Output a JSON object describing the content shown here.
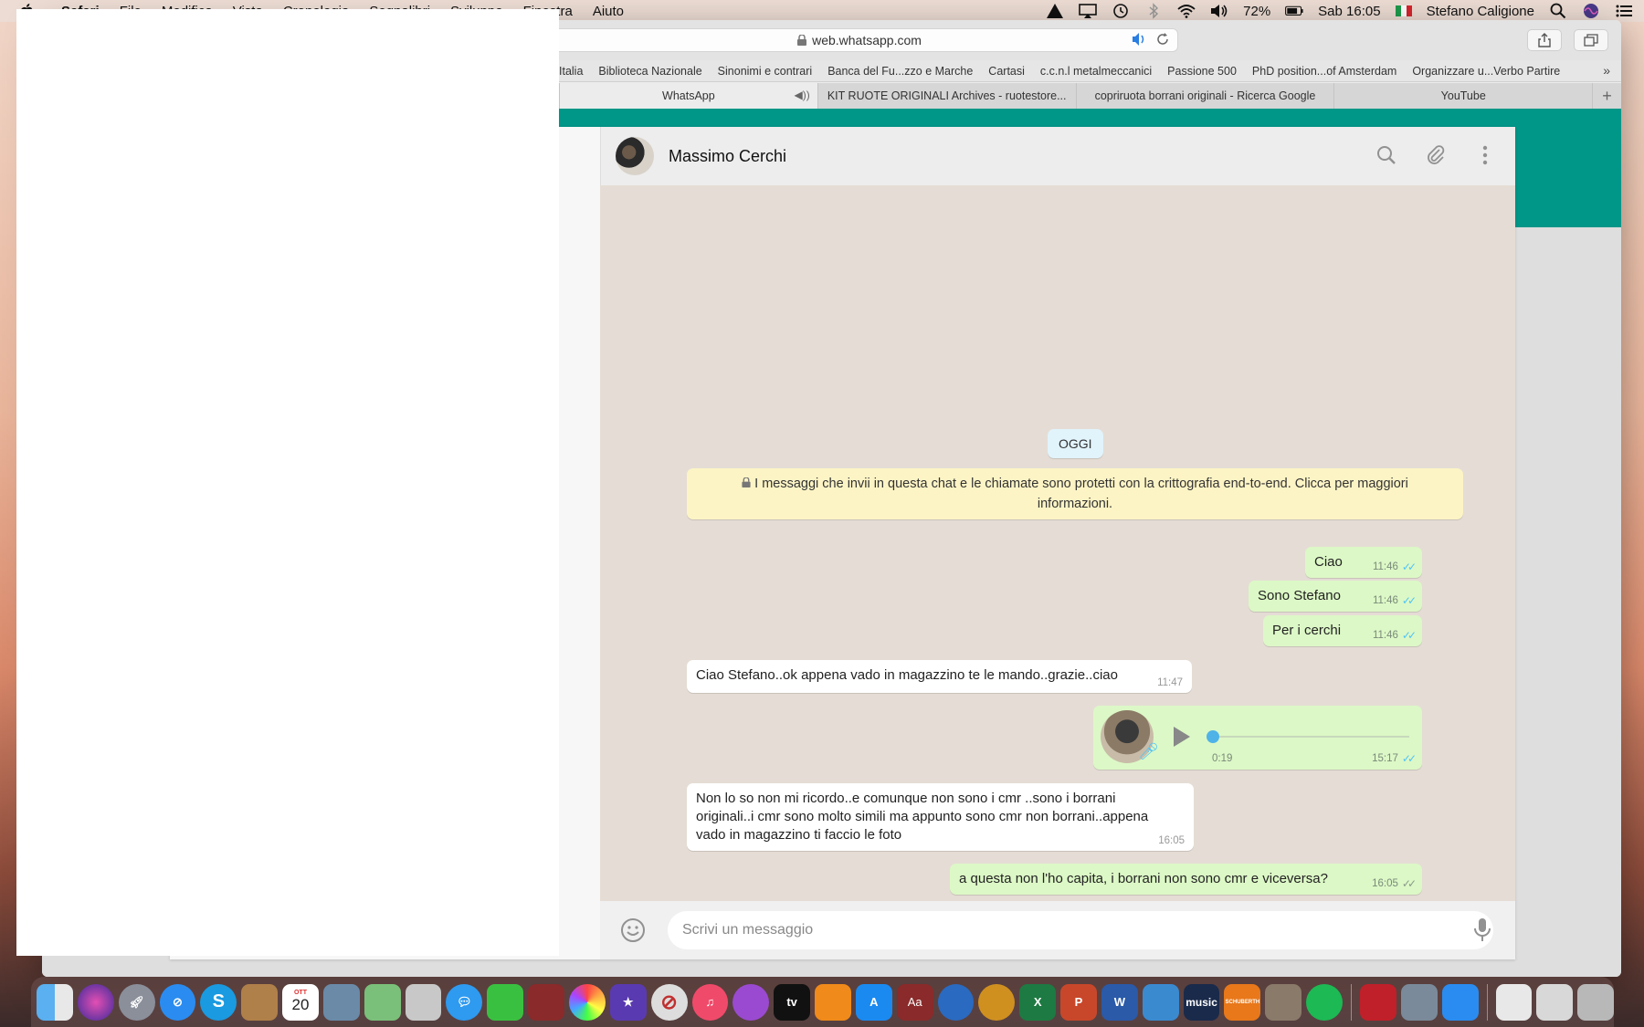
{
  "menubar": {
    "menus": [
      "Safari",
      "File",
      "Modifica",
      "Vista",
      "Cronologia",
      "Segnalibri",
      "Sviluppo",
      "Finestra",
      "Aiuto"
    ],
    "battery": "72%",
    "clock": "Sab 16:05",
    "user": "Stefano Caligione"
  },
  "browser": {
    "url": "web.whatsapp.com",
    "bookmarks": [
      "Italia",
      "Biblioteca Nazionale",
      "Sinonimi e contrari",
      "Banca del Fu...zzo e Marche",
      "Cartasi",
      "c.c.n.l metalmeccanici",
      "Passione 500",
      "PhD position...of Amsterdam",
      "Organizzare u...Verbo Partire"
    ],
    "tabs": [
      {
        "title": "WhatsApp",
        "active": true
      },
      {
        "title": "KIT RUOTE ORIGINALI Archives - ruotestore...",
        "active": false
      },
      {
        "title": "copriruota borrani originali - Ricerca Google",
        "active": false
      },
      {
        "title": "YouTube",
        "active": false
      }
    ]
  },
  "chat": {
    "contact_name": "Massimo Cerchi",
    "day_label": "OGGI",
    "encryption_notice": "I messaggi che invii in questa chat e le chiamate sono protetti con la crittografia end-to-end. Clicca per maggiori informazioni.",
    "messages": [
      {
        "dir": "out",
        "text": "Ciao",
        "time": "11:46"
      },
      {
        "dir": "out",
        "text": "Sono Stefano",
        "time": "11:46"
      },
      {
        "dir": "out",
        "text": "Per i cerchi",
        "time": "11:46"
      },
      {
        "dir": "in",
        "text": "Ciao Stefano..ok appena vado in magazzino te le mando..grazie..ciao",
        "time": "11:47"
      },
      {
        "dir": "out",
        "type": "voice",
        "duration": "0:19",
        "progress": 0,
        "time": "15:17"
      },
      {
        "dir": "in",
        "text": "Non lo so non mi ricordo..e comunque non sono i cmr ..sono i borrani originali..i cmr sono molto simili ma appunto sono cmr non borrani..appena vado in magazzino ti faccio le foto",
        "time": "16:05"
      },
      {
        "dir": "out",
        "text": "a questa non l'ho capita, i borrani non sono cmr e viceversa?",
        "time": "16:05"
      }
    ],
    "composer_placeholder": "Scrivi un messaggio"
  },
  "dock": {
    "calendar_month": "OTT",
    "calendar_day": "20",
    "labels": [
      "S",
      "music",
      "SCHUBERTH",
      "X",
      "P",
      "W",
      "Aa"
    ]
  },
  "colors": {
    "wa_green": "#009688",
    "outgoing_bubble": "#dcf8c6",
    "incoming_bubble": "#ffffff",
    "read_ticks": "#4fc3f7"
  }
}
